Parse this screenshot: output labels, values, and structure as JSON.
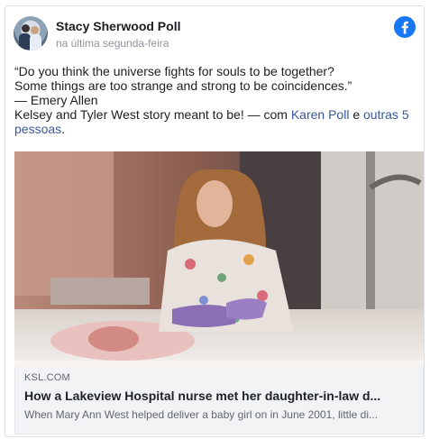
{
  "post": {
    "author": "Stacy Sherwood Poll",
    "timestamp": "na última segunda-feira",
    "text_lines": [
      "“Do you think the universe fights for souls to be together?",
      "Some things are too strange and strong to be coincidences.”",
      "— Emery Allen"
    ],
    "story_text": "Kelsey and Tyler West story meant to be!",
    "with_prefix": " — com ",
    "tag_person": "Karen Poll",
    "tag_connector": " e ",
    "tag_others": "outras 5 pessoas",
    "tag_end": "."
  },
  "link_preview": {
    "domain": "KSL.COM",
    "headline": "How a Lakeview Hospital nurse met her daughter-in-law d...",
    "description": "When Mary Ann West helped deliver a baby girl on in June 2001, little di..."
  },
  "icons": {
    "platform": "facebook-icon",
    "brand_color": "#1877f2"
  }
}
